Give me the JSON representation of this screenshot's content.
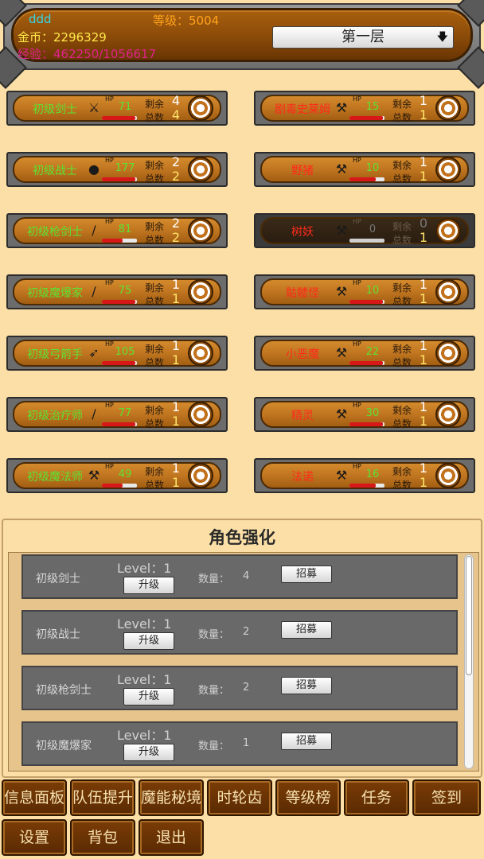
{
  "header": {
    "player_name": "ddd",
    "level_text": "等级：5004",
    "gold_text": "金币：2296329",
    "exp_text": "经验：462250/1056617",
    "floor_select": "第一层",
    "floor_arrow_icon": "arrow-down-icon"
  },
  "allies": [
    {
      "name": "初级剑士",
      "icon": "sword-icon",
      "hp": "71",
      "hp_fraction": 0.95,
      "remain_label": "剩余",
      "remain": "4",
      "total_label": "总数",
      "total": "4"
    },
    {
      "name": "初级战士",
      "icon": "shield-icon",
      "hp": "177",
      "hp_fraction": 0.95,
      "remain_label": "剩余",
      "remain": "2",
      "total_label": "总数",
      "total": "2"
    },
    {
      "name": "初级枪剑士",
      "icon": "spear-icon",
      "hp": "81",
      "hp_fraction": 0.6,
      "remain_label": "剩余",
      "remain": "2",
      "total_label": "总数",
      "total": "2"
    },
    {
      "name": "初级魔爆家",
      "icon": "staff-icon",
      "hp": "75",
      "hp_fraction": 0.95,
      "remain_label": "剩余",
      "remain": "1",
      "total_label": "总数",
      "total": "1"
    },
    {
      "name": "初级弓箭手",
      "icon": "bow-icon",
      "hp": "105",
      "hp_fraction": 0.95,
      "remain_label": "剩余",
      "remain": "1",
      "total_label": "总数",
      "total": "1"
    },
    {
      "name": "初级治疗师",
      "icon": "wand-icon",
      "hp": "77",
      "hp_fraction": 0.95,
      "remain_label": "剩余",
      "remain": "1",
      "total_label": "总数",
      "total": "1"
    },
    {
      "name": "初级魔法师",
      "icon": "magic-staff-icon",
      "hp": "49",
      "hp_fraction": 0.6,
      "remain_label": "剩余",
      "remain": "1",
      "total_label": "总数",
      "total": "1"
    }
  ],
  "enemies": [
    {
      "name": "剧毒史莱姆",
      "icon": "axe-icon",
      "hp": "15",
      "hp_fraction": 0.95,
      "remain_label": "剩余",
      "remain": "1",
      "total_label": "总数",
      "total": "1",
      "dead": false
    },
    {
      "name": "野猪",
      "icon": "axe-icon",
      "hp": "10",
      "hp_fraction": 0.75,
      "remain_label": "剩余",
      "remain": "1",
      "total_label": "总数",
      "total": "1",
      "dead": false
    },
    {
      "name": "树妖",
      "icon": "axe-icon",
      "hp": "0",
      "hp_fraction": 0.0,
      "remain_label": "剩余",
      "remain": "0",
      "total_label": "总数",
      "total": "1",
      "dead": true
    },
    {
      "name": "骷髅怪",
      "icon": "axe-icon",
      "hp": "10",
      "hp_fraction": 0.95,
      "remain_label": "剩余",
      "remain": "1",
      "total_label": "总数",
      "total": "1",
      "dead": false
    },
    {
      "name": "小恶魔",
      "icon": "axe-icon",
      "hp": "22",
      "hp_fraction": 0.95,
      "remain_label": "剩余",
      "remain": "1",
      "total_label": "总数",
      "total": "1",
      "dead": false
    },
    {
      "name": "精灵",
      "icon": "axe-icon",
      "hp": "30",
      "hp_fraction": 0.95,
      "remain_label": "剩余",
      "remain": "1",
      "total_label": "总数",
      "total": "1",
      "dead": false
    },
    {
      "name": "法诺",
      "icon": "axe-icon",
      "hp": "16",
      "hp_fraction": 0.75,
      "remain_label": "剩余",
      "remain": "1",
      "total_label": "总数",
      "total": "1",
      "dead": false
    }
  ],
  "upgrade": {
    "title": "角色强化",
    "rows": [
      {
        "name": "初级剑士",
        "level": "Level：1",
        "upgrade_label": "升级",
        "count_label": "数量：",
        "count": "4",
        "recruit_label": "招募"
      },
      {
        "name": "初级战士",
        "level": "Level：1",
        "upgrade_label": "升级",
        "count_label": "数量：",
        "count": "2",
        "recruit_label": "招募"
      },
      {
        "name": "初级枪剑士",
        "level": "Level：1",
        "upgrade_label": "升级",
        "count_label": "数量：",
        "count": "2",
        "recruit_label": "招募"
      },
      {
        "name": "初级魔爆家",
        "level": "Level：1",
        "upgrade_label": "升级",
        "count_label": "数量：",
        "count": "1",
        "recruit_label": "招募"
      }
    ]
  },
  "menu": [
    {
      "label": "信息面板"
    },
    {
      "label": "队伍提升"
    },
    {
      "label": "魔能秘境"
    },
    {
      "label": "时轮齿"
    },
    {
      "label": "等级榜"
    },
    {
      "label": "任务"
    },
    {
      "label": "签到"
    },
    {
      "label": "设置"
    },
    {
      "label": "背包"
    },
    {
      "label": "退出"
    }
  ],
  "colors": {
    "background": "#fbdfa6",
    "ally_name": "#5de232",
    "enemy_name": "#ff2a1a",
    "hp_bar": "#d81818",
    "menu_button": "#6a3204"
  }
}
